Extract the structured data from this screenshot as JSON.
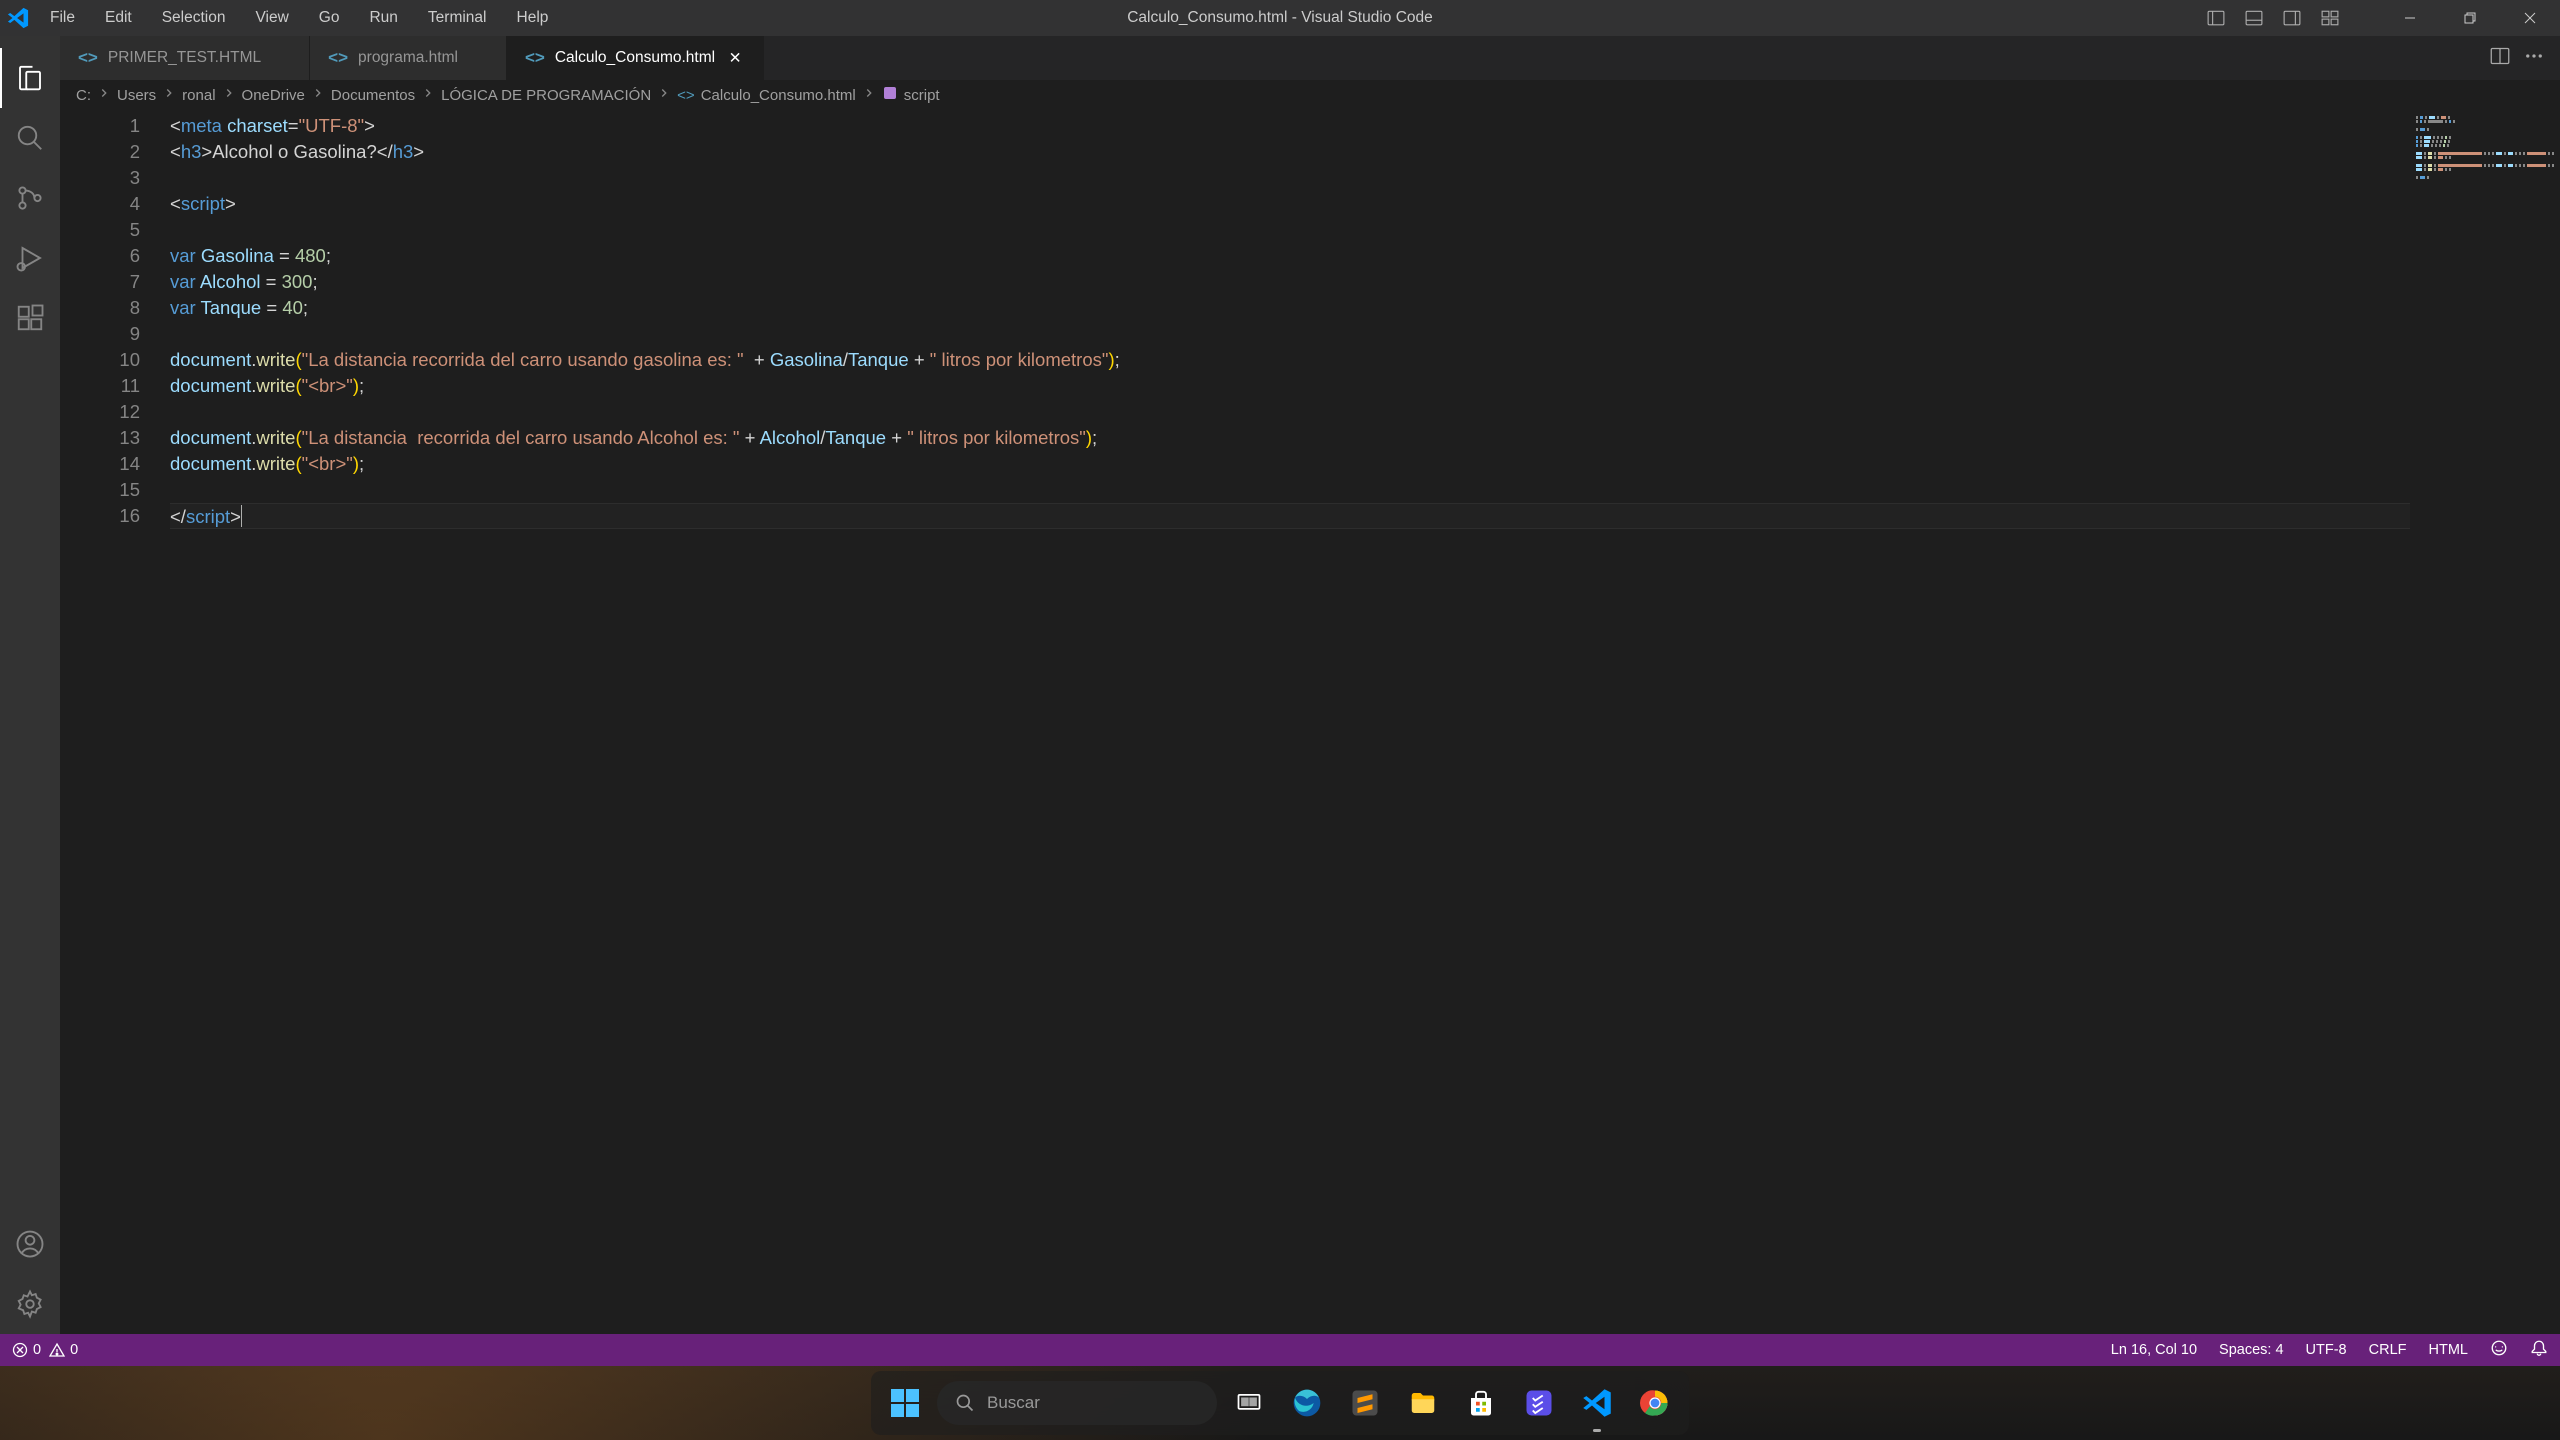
{
  "title": "Calculo_Consumo.html - Visual Studio Code",
  "menu": [
    "File",
    "Edit",
    "Selection",
    "View",
    "Go",
    "Run",
    "Terminal",
    "Help"
  ],
  "tabs": [
    {
      "label": "PRIMER_TEST.HTML",
      "active": false
    },
    {
      "label": "programa.html",
      "active": false
    },
    {
      "label": "Calculo_Consumo.html",
      "active": true
    }
  ],
  "breadcrumbs": {
    "parts": [
      "C:",
      "Users",
      "ronal",
      "OneDrive",
      "Documentos",
      "LÓGICA DE PROGRAMACIÓN"
    ],
    "file": "Calculo_Consumo.html",
    "symbol": "script"
  },
  "statusbar": {
    "errors": "0",
    "warnings": "0",
    "lncol": "Ln 16, Col 10",
    "spaces": "Spaces: 4",
    "encoding": "UTF-8",
    "eol": "CRLF",
    "lang": "HTML"
  },
  "taskbar": {
    "search_placeholder": "Buscar"
  },
  "code": {
    "lines": [
      {
        "n": 1,
        "tokens": [
          [
            "bracket-punct",
            "<"
          ],
          [
            "tag",
            "meta"
          ],
          [
            "text-content",
            " "
          ],
          [
            "attr-name",
            "charset"
          ],
          [
            "operator",
            "="
          ],
          [
            "string",
            "\"UTF-8\""
          ],
          [
            "bracket-punct",
            ">"
          ]
        ]
      },
      {
        "n": 2,
        "tokens": [
          [
            "bracket-punct",
            "<"
          ],
          [
            "tag",
            "h3"
          ],
          [
            "bracket-punct",
            ">"
          ],
          [
            "text-content",
            "Alcohol o Gasolina?"
          ],
          [
            "bracket-punct",
            "</"
          ],
          [
            "tag",
            "h3"
          ],
          [
            "bracket-punct",
            ">"
          ]
        ]
      },
      {
        "n": 3,
        "tokens": []
      },
      {
        "n": 4,
        "tokens": [
          [
            "bracket-punct",
            "<"
          ],
          [
            "tag",
            "script"
          ],
          [
            "bracket-punct",
            ">"
          ]
        ]
      },
      {
        "n": 5,
        "tokens": []
      },
      {
        "n": 6,
        "tokens": [
          [
            "keyword",
            "var"
          ],
          [
            "text-content",
            " "
          ],
          [
            "variable",
            "Gasolina"
          ],
          [
            "text-content",
            " "
          ],
          [
            "operator",
            "="
          ],
          [
            "text-content",
            " "
          ],
          [
            "number",
            "480"
          ],
          [
            "punct",
            ";"
          ]
        ]
      },
      {
        "n": 7,
        "tokens": [
          [
            "keyword",
            "var"
          ],
          [
            "text-content",
            " "
          ],
          [
            "variable",
            "Alcohol"
          ],
          [
            "text-content",
            " "
          ],
          [
            "operator",
            "="
          ],
          [
            "text-content",
            " "
          ],
          [
            "number",
            "300"
          ],
          [
            "punct",
            ";"
          ]
        ]
      },
      {
        "n": 8,
        "tokens": [
          [
            "keyword",
            "var"
          ],
          [
            "text-content",
            " "
          ],
          [
            "variable",
            "Tanque"
          ],
          [
            "text-content",
            " "
          ],
          [
            "operator",
            "="
          ],
          [
            "text-content",
            " "
          ],
          [
            "number",
            "40"
          ],
          [
            "punct",
            ";"
          ]
        ]
      },
      {
        "n": 9,
        "tokens": []
      },
      {
        "n": 10,
        "tokens": [
          [
            "object",
            "document"
          ],
          [
            "punct",
            "."
          ],
          [
            "method",
            "write"
          ],
          [
            "bracket",
            "("
          ],
          [
            "string",
            "\"La distancia recorrida del carro usando gasolina es: \""
          ],
          [
            "text-content",
            "  "
          ],
          [
            "operator",
            "+"
          ],
          [
            "text-content",
            " "
          ],
          [
            "variable",
            "Gasolina"
          ],
          [
            "operator",
            "/"
          ],
          [
            "variable",
            "Tanque"
          ],
          [
            "text-content",
            " "
          ],
          [
            "operator",
            "+"
          ],
          [
            "text-content",
            " "
          ],
          [
            "string",
            "\" litros por kilometros\""
          ],
          [
            "bracket",
            ")"
          ],
          [
            "punct",
            ";"
          ]
        ]
      },
      {
        "n": 11,
        "tokens": [
          [
            "object",
            "document"
          ],
          [
            "punct",
            "."
          ],
          [
            "method",
            "write"
          ],
          [
            "bracket",
            "("
          ],
          [
            "string",
            "\"<br>\""
          ],
          [
            "bracket",
            ")"
          ],
          [
            "punct",
            ";"
          ]
        ]
      },
      {
        "n": 12,
        "tokens": []
      },
      {
        "n": 13,
        "tokens": [
          [
            "object",
            "document"
          ],
          [
            "punct",
            "."
          ],
          [
            "method",
            "write"
          ],
          [
            "bracket",
            "("
          ],
          [
            "string",
            "\"La distancia  recorrida del carro usando Alcohol es: \""
          ],
          [
            "text-content",
            " "
          ],
          [
            "operator",
            "+"
          ],
          [
            "text-content",
            " "
          ],
          [
            "variable",
            "Alcohol"
          ],
          [
            "operator",
            "/"
          ],
          [
            "variable",
            "Tanque"
          ],
          [
            "text-content",
            " "
          ],
          [
            "operator",
            "+"
          ],
          [
            "text-content",
            " "
          ],
          [
            "string",
            "\" litros por kilometros\""
          ],
          [
            "bracket",
            ")"
          ],
          [
            "punct",
            ";"
          ]
        ]
      },
      {
        "n": 14,
        "tokens": [
          [
            "object",
            "document"
          ],
          [
            "punct",
            "."
          ],
          [
            "method",
            "write"
          ],
          [
            "bracket",
            "("
          ],
          [
            "string",
            "\"<br>\""
          ],
          [
            "bracket",
            ")"
          ],
          [
            "punct",
            ";"
          ]
        ]
      },
      {
        "n": 15,
        "tokens": []
      },
      {
        "n": 16,
        "current": true,
        "tokens": [
          [
            "bracket-punct",
            "</"
          ],
          [
            "tag",
            "script"
          ],
          [
            "bracket-punct",
            ">"
          ]
        ],
        "cursor": true
      }
    ]
  }
}
